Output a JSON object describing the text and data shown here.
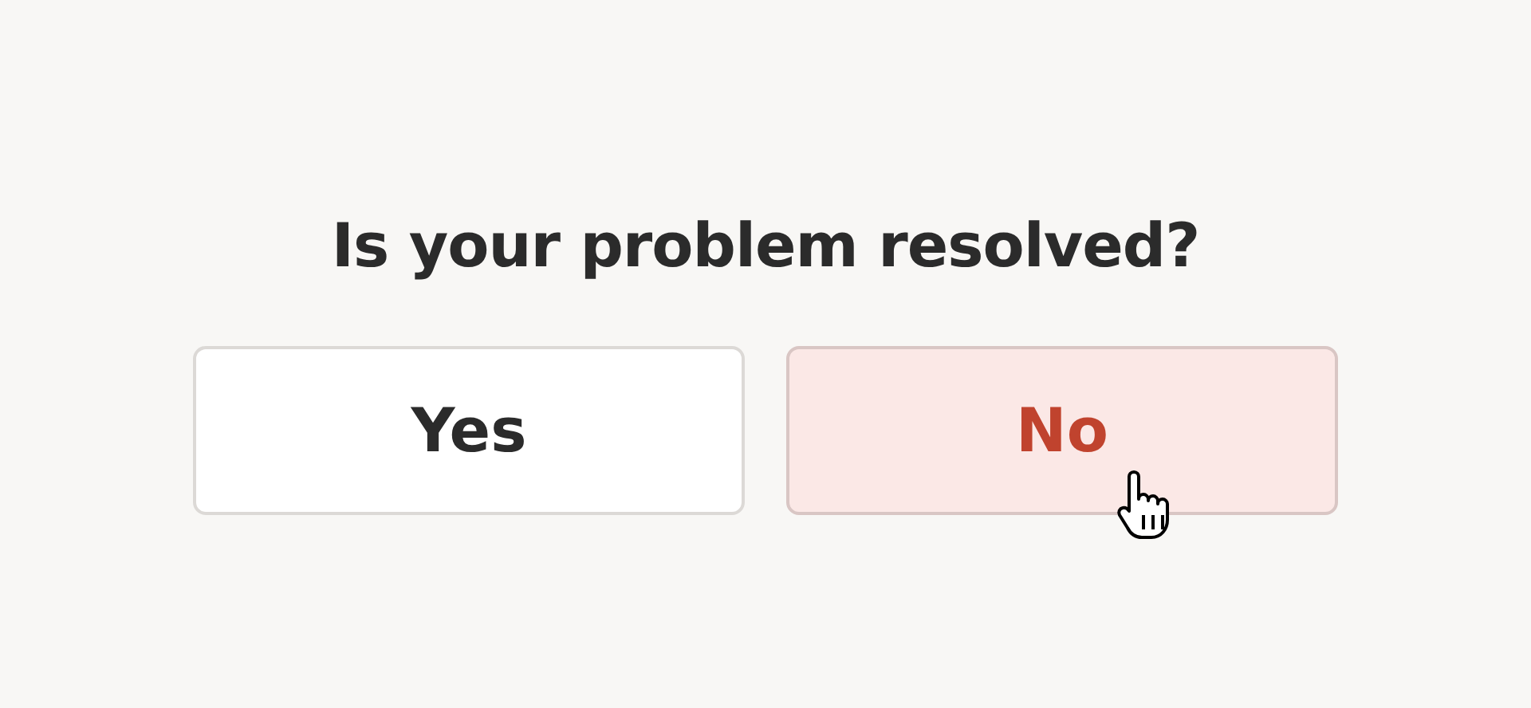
{
  "question": "Is your problem resolved?",
  "buttons": [
    {
      "label": "Yes",
      "selected": false
    },
    {
      "label": "No",
      "selected": true
    }
  ]
}
